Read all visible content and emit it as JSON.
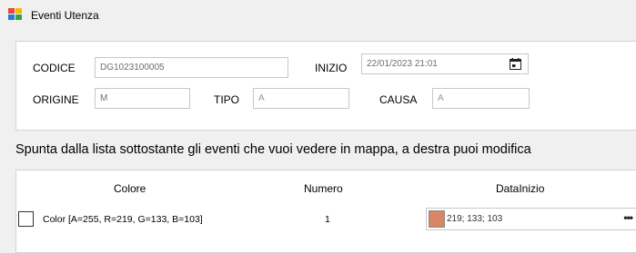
{
  "window": {
    "title": "Eventi Utenza"
  },
  "form": {
    "codice_label": "CODICE",
    "codice_value": "DG1023100005",
    "inizio_label": "INIZIO",
    "inizio_value": "22/01/2023 21:01",
    "origine_label": "ORIGINE",
    "origine_value": "M",
    "tipo_label": "TIPO",
    "tipo_value": "A",
    "causa_label": "CAUSA",
    "causa_value": "A"
  },
  "instruction": "Spunta dalla lista sottostante gli eventi che vuoi vedere in mappa, a destra puoi modifica",
  "grid": {
    "columns": [
      "Colore",
      "Numero",
      "DataInizio"
    ],
    "rows": [
      {
        "checked": false,
        "colore": "Color [A=255, R=219, G=133, B=103]",
        "numero": "1",
        "color_value": "219; 133; 103",
        "swatch_color": "#db8567"
      }
    ]
  },
  "colors": {
    "app_icon": [
      "#e8482c",
      "#f5b800",
      "#2b7bd6",
      "#3aa53a"
    ]
  },
  "icons": {
    "calendar": "calendar-icon",
    "ellipsis": "ellipsis-button"
  }
}
